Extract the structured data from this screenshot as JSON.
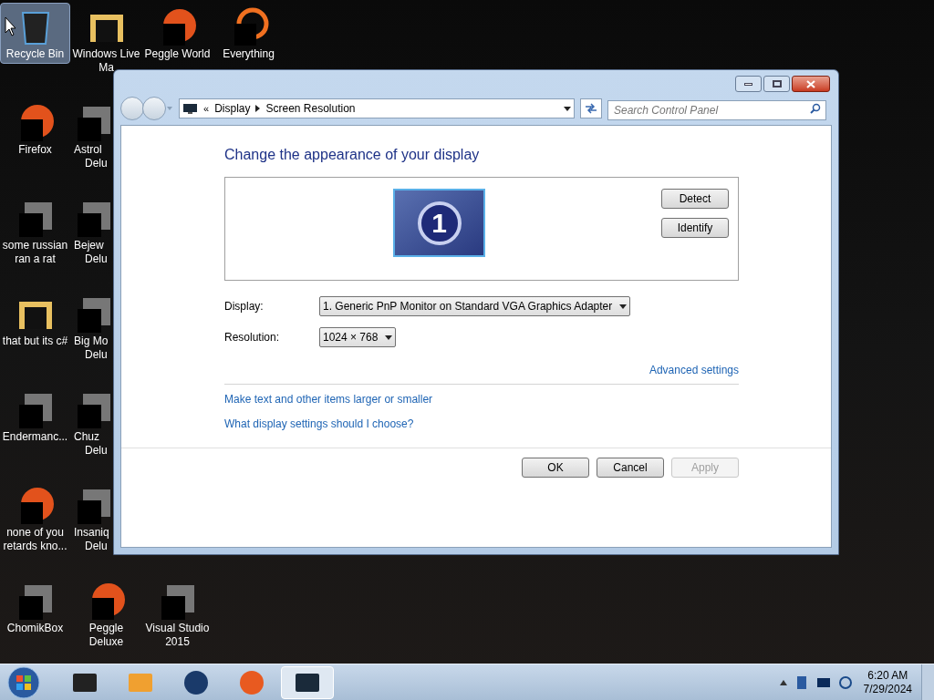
{
  "desktop_icons": [
    {
      "label": "Recycle Bin",
      "selected": true,
      "kind": "bin"
    },
    {
      "label": "Windows Live",
      "label_2": "Ma",
      "selected": false,
      "kind": "folder"
    },
    {
      "label": "Peggle World",
      "selected": false,
      "kind": "ball"
    },
    {
      "label": "Everything",
      "selected": false,
      "kind": "ring"
    },
    {
      "label": "Firefox",
      "selected": false,
      "kind": "ball"
    },
    {
      "label": "Astrol",
      "label_2": "Delu",
      "selected": false,
      "kind": "app"
    },
    {
      "label": "some russian ran a rat",
      "selected": false,
      "kind": "app"
    },
    {
      "label": "Bejew",
      "label_2": "Delu",
      "selected": false,
      "kind": "app"
    },
    {
      "label": "that but its c#",
      "selected": false,
      "kind": "folder"
    },
    {
      "label": "Big Mo",
      "label_2": "Delu",
      "selected": false,
      "kind": "app"
    },
    {
      "label": "Endermanc...",
      "selected": false,
      "kind": "app"
    },
    {
      "label": "Chuz",
      "label_2": "Delu",
      "selected": false,
      "kind": "app"
    },
    {
      "label": "none of you retards kno...",
      "selected": false,
      "kind": "ball"
    },
    {
      "label": "Insaniq",
      "label_2": "Delu",
      "selected": false,
      "kind": "app"
    },
    {
      "label": "ChomikBox",
      "selected": false,
      "kind": "app"
    },
    {
      "label": "Peggle Deluxe",
      "selected": false,
      "kind": "ball"
    },
    {
      "label": "Visual Studio 2015",
      "selected": false,
      "kind": "app"
    }
  ],
  "window": {
    "overflow_mark": "«",
    "breadcrumb": [
      "Display",
      "Screen Resolution"
    ],
    "search": {
      "placeholder": "Search Control Panel"
    },
    "heading": "Change the appearance of your display",
    "monitor_number": "1",
    "side_buttons": [
      "Detect",
      "Identify"
    ],
    "fields": [
      {
        "label": "Display:",
        "value": "1. Generic PnP Monitor on Standard VGA Graphics Adapter"
      },
      {
        "label": "Resolution:",
        "value": "1024 × 768"
      }
    ],
    "advanced_link": "Advanced settings",
    "links": [
      "Make text and other items larger or smaller",
      "What display settings should I choose?"
    ],
    "buttons": [
      {
        "label": "OK",
        "disabled": false
      },
      {
        "label": "Cancel",
        "disabled": false
      },
      {
        "label": "Apply",
        "disabled": true
      }
    ]
  },
  "taskbar": {
    "items": [
      {
        "kind": "box",
        "selected": false
      },
      {
        "kind": "player",
        "selected": false
      },
      {
        "kind": "globe",
        "selected": false
      },
      {
        "kind": "ball",
        "selected": false
      },
      {
        "kind": "display",
        "selected": true
      }
    ],
    "time": "6:20 AM",
    "date": "7/29/2024"
  }
}
